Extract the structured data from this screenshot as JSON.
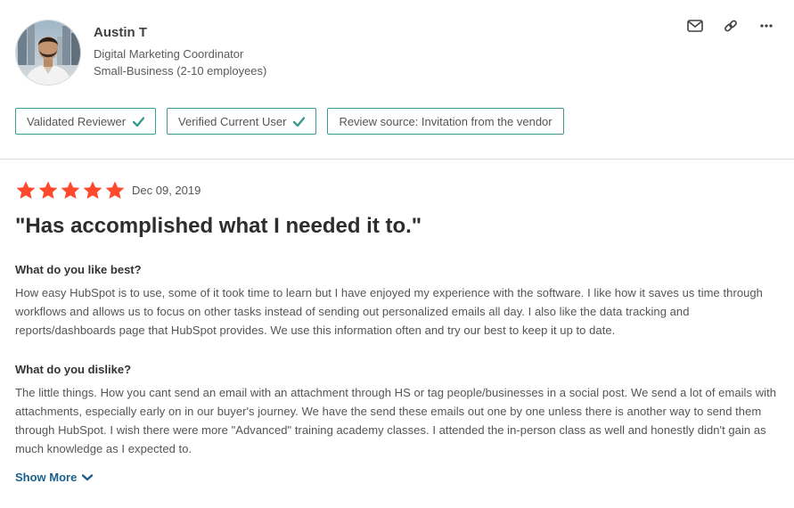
{
  "reviewer": {
    "name": "Austin T",
    "title": "Digital Marketing Coordinator",
    "company": "Small-Business (2-10 employees)"
  },
  "actions": [
    {
      "icon": "mail-icon"
    },
    {
      "icon": "link-icon"
    },
    {
      "icon": "more-options-icon"
    }
  ],
  "badges": [
    {
      "label": "Validated Reviewer",
      "icon": "check-icon"
    },
    {
      "label": "Verified Current User",
      "icon": "check-icon"
    },
    {
      "label": "Review source: Invitation from the vendor"
    }
  ],
  "review": {
    "rating": 5,
    "rating_max": 5,
    "star_color": "#ff492c",
    "date": "Dec 09, 2019",
    "title": "\"Has accomplished what I needed it to.\"",
    "like_heading": "What do you like best?",
    "like_text": "How easy HubSpot is to use, some of it took time to learn but I have enjoyed my experience with the software. I like how it saves us time through workflows and allows us to focus on other tasks instead of sending out personalized emails all day. I also like the data tracking and reports/dashboards page that HubSpot provides. We use this information often and try our best to keep it up to date.",
    "dislike_heading": "What do you dislike?",
    "dislike_text": "The little things. How you cant send an email with an attachment through HS or tag people/businesses in a social post. We send a lot of emails with attachments, especially early on in our buyer's journey. We have the send these emails out one by one unless there is another way to send them through HubSpot. I wish there were more \"Advanced\" training academy classes. I attended the in-person class as well and honestly didn't gain as much knowledge as I expected to.",
    "show_more": "Show More"
  },
  "colors": {
    "accent_teal": "#3a9a8f",
    "link_blue": "#1a5f8a",
    "star": "#ff492c"
  }
}
